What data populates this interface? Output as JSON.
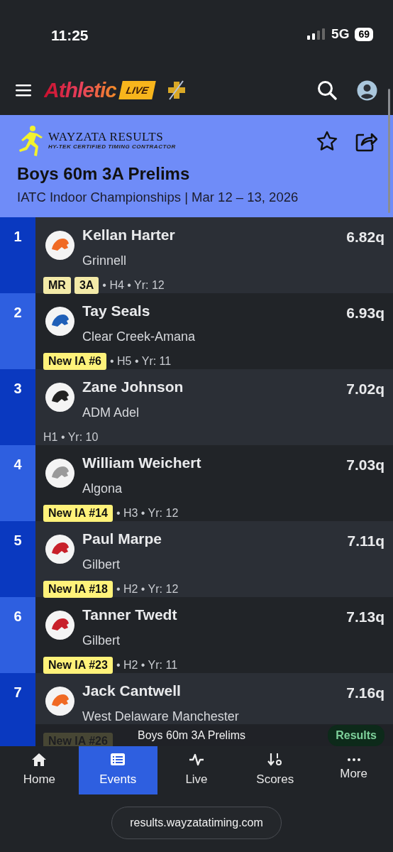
{
  "status_bar": {
    "time": "11:25",
    "network": "5G",
    "battery": "69"
  },
  "navbar": {
    "brand": "Athletic",
    "brand_badge": "LIVE"
  },
  "meet_header": {
    "org_name": "WAYZATA RESULTS",
    "org_tagline": "HY-TEK CERTIFIED TIMING CONTRACTOR",
    "title": "Boys 60m 3A Prelims",
    "subtitle": "IATC Indoor Championships | Mar 12 – 13, 2026",
    "favorited": false
  },
  "results": [
    {
      "place": "1",
      "name": "Kellan Harter",
      "school": "Grinnell",
      "mark": "6.82q",
      "color": "#f06a24",
      "tags": [
        {
          "label": "MR",
          "kind": "record"
        },
        {
          "label": "3A",
          "kind": "record"
        }
      ],
      "meta": "• H4 • Yr: 12"
    },
    {
      "place": "2",
      "name": "Tay Seals",
      "school": "Clear Creek-Amana",
      "mark": "6.93q",
      "color": "#1f5fb8",
      "tags": [
        {
          "label": "New IA #6",
          "kind": "new"
        }
      ],
      "meta": "• H5 • Yr: 11"
    },
    {
      "place": "3",
      "name": "Zane Johnson",
      "school": "ADM Adel",
      "mark": "7.02q",
      "color": "#222222",
      "meta": "H1 • Yr: 10"
    },
    {
      "place": "4",
      "name": "William Weichert",
      "school": "Algona",
      "mark": "7.03q",
      "color": "#9a9a9a",
      "tags": [
        {
          "label": "New IA #14",
          "kind": "new"
        }
      ],
      "meta": "• H3 • Yr: 12"
    },
    {
      "place": "5",
      "name": "Paul Marpe",
      "school": "Gilbert",
      "mark": "7.11q",
      "color": "#c8202a",
      "tags": [
        {
          "label": "New IA #18",
          "kind": "new"
        }
      ],
      "meta": "• H2 • Yr: 12"
    },
    {
      "place": "6",
      "name": "Tanner Twedt",
      "school": "Gilbert",
      "mark": "7.13q",
      "color": "#c8202a",
      "tags": [
        {
          "label": "New IA #23",
          "kind": "new"
        }
      ],
      "meta": "• H2 • Yr: 11"
    },
    {
      "place": "7",
      "name": "Jack Cantwell",
      "school": "West Delaware Manchester",
      "mark": "7.16q",
      "color": "#f06a24",
      "tags": [
        {
          "label": "New IA #26",
          "kind": "new"
        }
      ]
    }
  ],
  "mini_bar": {
    "title": "Boys 60m 3A Prelims",
    "button": "Results"
  },
  "tabs": [
    {
      "label": "Home",
      "selected": false
    },
    {
      "label": "Events",
      "selected": true
    },
    {
      "label": "Live",
      "selected": false
    },
    {
      "label": "Scores",
      "selected": false
    },
    {
      "label": "More",
      "selected": false
    }
  ],
  "url": "results.wayzatatiming.com"
}
